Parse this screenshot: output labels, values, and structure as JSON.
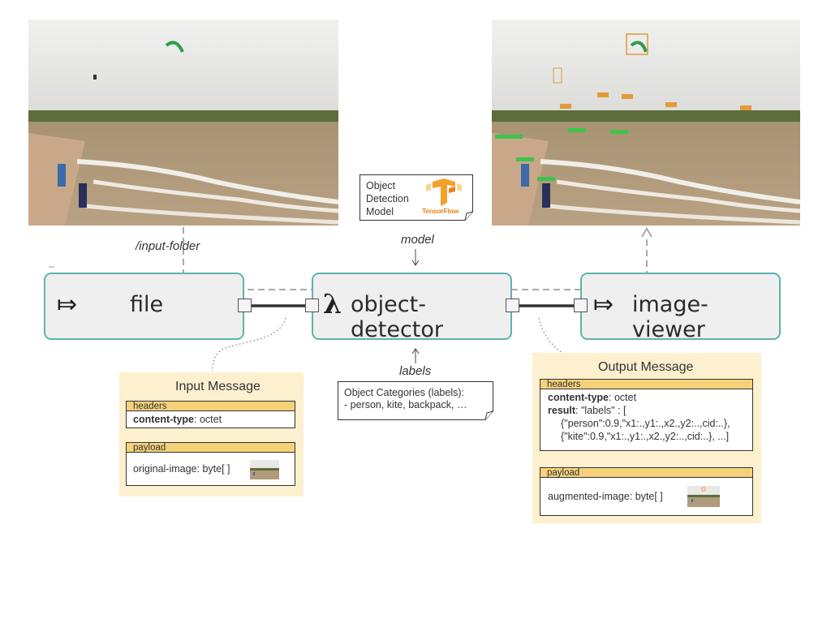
{
  "flow": {
    "source": {
      "icon": "source-arrow-icon",
      "label": "file"
    },
    "processor": {
      "icon": "lambda-icon",
      "label": "object-detector"
    },
    "sink": {
      "icon": "sink-arrow-icon",
      "label": "image-viewer"
    }
  },
  "labels": {
    "input_folder": "/input-folder",
    "model": "model",
    "labels": "labels"
  },
  "model_note": {
    "line1": "Object",
    "line2": "Detection",
    "line3": "Model",
    "logo_text": "TensorFlow"
  },
  "categories_note": {
    "line1": "Object Categories (labels):",
    "line2": "- person, kite, backpack, …"
  },
  "input_message": {
    "title": "Input Message",
    "headers_label": "headers",
    "content_type_key": "content-type",
    "content_type_value": ": octet",
    "payload_label": "payload",
    "payload_text": "original-image: byte[ ]"
  },
  "output_message": {
    "title": "Output Message",
    "headers_label": "headers",
    "content_type_key": "content-type",
    "content_type_value": ": octet",
    "result_key": "result",
    "result_line1": ": \"labels\" : [",
    "result_line2": "{\"person\":0.9,\"x1:.,y1:.,x2.,y2:..,cid:..},",
    "result_line3": "{\"kite\":0.9,\"x1:.,y1:.,x2.,y2:..,cid:..}, ...]",
    "payload_label": "payload",
    "payload_text": "augmented-image: byte[ ]"
  },
  "colors": {
    "box_border": "#5fb3ad",
    "box_fill": "#efefef",
    "panel_fill": "#fdf0cf",
    "section_bar": "#f5d27a",
    "tensorflow_orange": "#f4a12a"
  }
}
